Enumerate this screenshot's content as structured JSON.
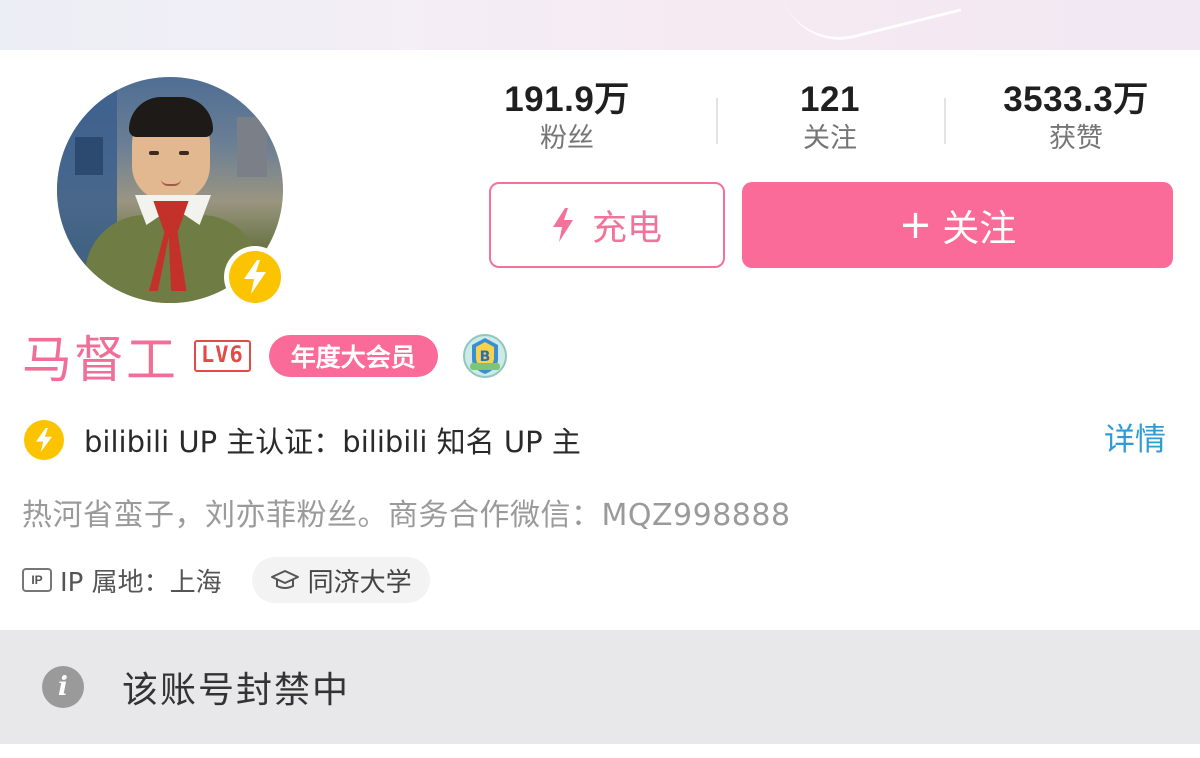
{
  "stats": [
    {
      "value": "191.9万",
      "label": "粉丝"
    },
    {
      "value": "121",
      "label": "关注"
    },
    {
      "value": "3533.3万",
      "label": "获赞"
    }
  ],
  "buttons": {
    "charge_label": "充电",
    "follow_plus": "+",
    "follow_label": "关注"
  },
  "profile": {
    "username": "马督工",
    "level": "LV6",
    "vip_label": "年度大会员",
    "cert_text": "bilibili UP 主认证：bilibili 知名 UP 主",
    "detail_link": "详情",
    "bio": "热河省蛮子，刘亦菲粉丝。商务合作微信：MQZ998888",
    "ip_icon": "IP",
    "ip_location": "IP 属地：上海",
    "school": "同济大学"
  },
  "notice": {
    "text": "该账号封禁中",
    "icon": "i"
  },
  "colors": {
    "accent_pink": "#fa6b9a",
    "name_pink": "#f06f98",
    "charge_yellow": "#fbc300",
    "link_blue": "#2f9bd5",
    "level_red": "#e24b47"
  },
  "icons": [
    "lightning-icon",
    "charge-badge-icon",
    "medal-icon",
    "ip-icon",
    "graduation-cap-icon",
    "info-icon"
  ]
}
